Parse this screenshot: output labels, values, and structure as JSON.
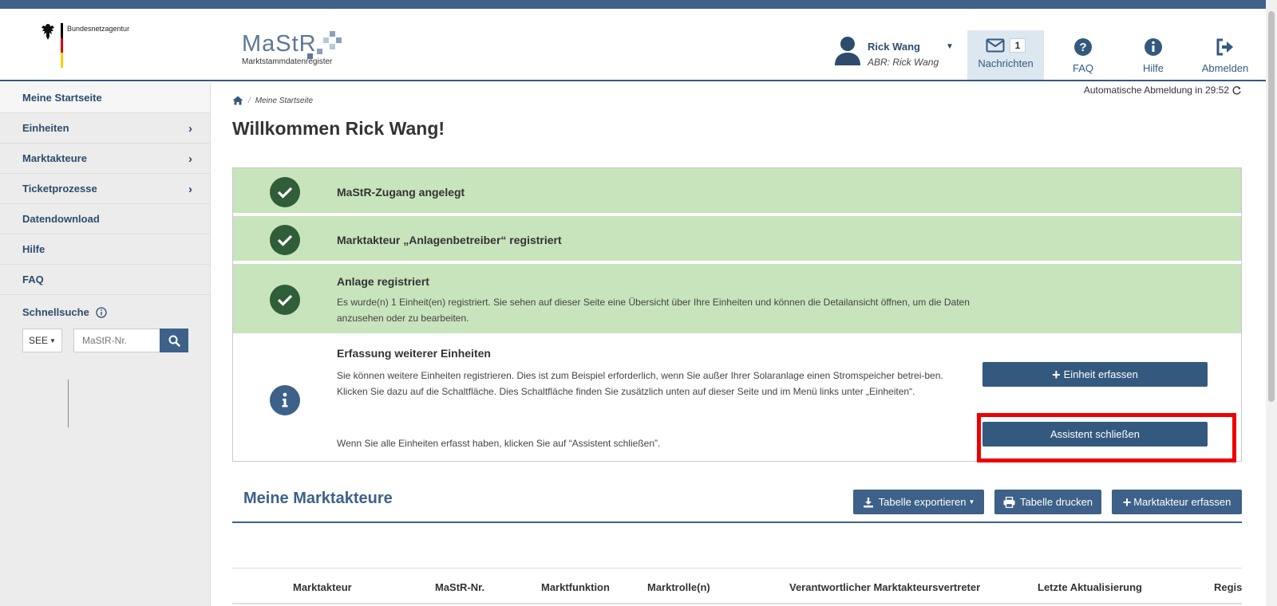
{
  "header": {
    "agency_name": "Bundesnetzagentur",
    "logo_text": "MaStR",
    "logo_sub": "Marktstammdatenregister",
    "user_name": "Rick Wang",
    "user_abr": "ABR: Rick Wang",
    "messages_count": "1",
    "messages_label": "Nachrichten",
    "faq_label": "FAQ",
    "help_label": "Hilfe",
    "logout_label": "Abmelden"
  },
  "sidebar": {
    "items": [
      {
        "label": "Meine Startseite"
      },
      {
        "label": "Einheiten"
      },
      {
        "label": "Marktakteure"
      },
      {
        "label": "Ticketprozesse"
      },
      {
        "label": "Datendownload"
      },
      {
        "label": "Hilfe"
      },
      {
        "label": "FAQ"
      }
    ],
    "quick_search_label": "Schnellsuche",
    "quick_select_value": "SEE",
    "quick_input_placeholder": "MaStR-Nr."
  },
  "main": {
    "auto_logout": "Automatische Abmeldung in 29:52",
    "breadcrumb": "Meine Startseite",
    "title": "Willkommen Rick Wang!",
    "steps": [
      {
        "title": "MaStR-Zugang angelegt"
      },
      {
        "title": "Marktakteur „Anlagenbetreiber“ registriert"
      },
      {
        "title": "Anlage registriert",
        "desc": "Es wurde(n) 1 Einheit(en) registriert. Sie sehen auf dieser Seite eine Übersicht über Ihre Einheiten und können die Detailansicht öffnen, um die Daten anzusehen oder zu bearbeiten."
      },
      {
        "title": "Erfassung weiterer Einheiten",
        "desc": "Sie können weitere Einheiten registrieren. Dies ist zum Beispiel erforderlich, wenn Sie außer Ihrer Solaranlage einen Stromspeicher betrei-ben. Klicken Sie dazu auf die Schaltfläche. Dies Schaltfläche finden Sie zusätzlich unten auf dieser Seite und im Menü links unter „Einheiten“.",
        "desc2": "Wenn Sie alle Einheiten erfasst haben, klicken Sie auf “Assistent schließen”."
      }
    ],
    "btn_add_unit": "Einheit erfassen",
    "btn_close_assistant": "Assistent schließen",
    "section_title": "Meine Marktakteure",
    "btn_export": "Tabelle exportieren",
    "btn_print": "Tabelle drucken",
    "btn_add_actor": "Marktakteur erfassen",
    "table_headers": [
      "Marktakteur",
      "MaStR-Nr.",
      "Marktfunktion",
      "Marktrolle(n)",
      "Verantwortlicher Marktakteursvertreter",
      "Letzte Aktualisierung",
      "Regis"
    ]
  }
}
